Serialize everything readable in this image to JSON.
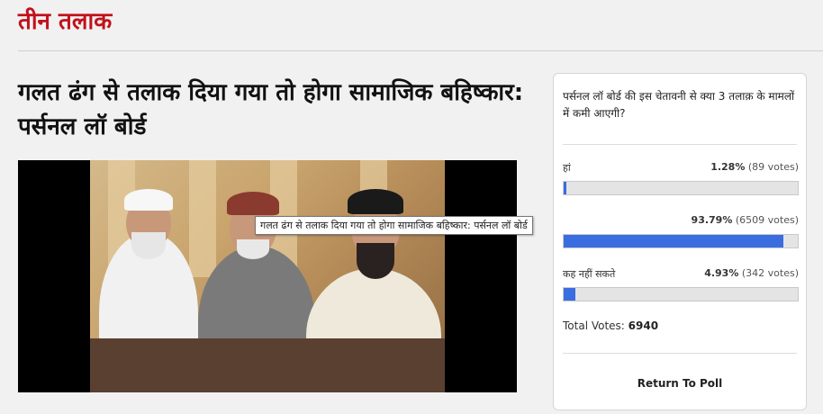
{
  "section": {
    "title": "तीन तलाक"
  },
  "article": {
    "headline": "गलत ढंग से तलाक दिया गया तो होगा सामाजिक बहिष्कार: पर्सनल लॉ बोर्ड",
    "image_tooltip": "गलत ढंग से तलाक दिया गया तो होगा सामाजिक बहिष्कार: पर्सनल लॉ बोर्ड"
  },
  "poll": {
    "question": "पर्सनल लॉ बोर्ड की इस चेतावनी से क्या 3 तलाक़ के मामलों में कमी आएगी?",
    "options": [
      {
        "label": "हां",
        "percent": "1.28%",
        "votes": "(89 votes)",
        "fraction": 0.0128
      },
      {
        "label": "",
        "percent": "93.79%",
        "votes": "(6509 votes)",
        "fraction": 0.9379
      },
      {
        "label": "कह नहीं सकते",
        "percent": "4.93%",
        "votes": "(342 votes)",
        "fraction": 0.0493
      }
    ],
    "total_label": "Total Votes:",
    "total_value": "6940",
    "return_label": "Return To Poll",
    "bar_color": "#3a6ee0"
  },
  "colors": {
    "section_title": "#c1121b"
  }
}
